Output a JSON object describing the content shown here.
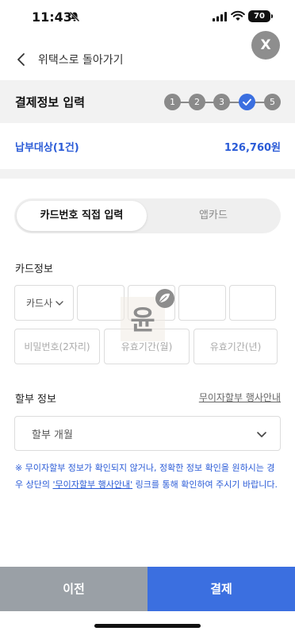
{
  "status_bar": {
    "time": "11:43",
    "battery": "70"
  },
  "close": {
    "label": "X"
  },
  "nav": {
    "back_label": "위택스로 돌아가기"
  },
  "step_header": {
    "title": "결제정보 입력",
    "steps": [
      "1",
      "2",
      "3",
      "",
      "5"
    ],
    "current_step": 4
  },
  "pay_target": {
    "label": "납부대상(1건)",
    "amount": "126,760원"
  },
  "tabs": {
    "direct": "카드번호 직접 입력",
    "app": "앱카드"
  },
  "card_info": {
    "label": "카드정보",
    "company_placeholder": "카드사",
    "password_placeholder": "비밀번호(2자리)",
    "expiry_month_placeholder": "유효기간(월)",
    "expiry_year_placeholder": "유효기간(년)"
  },
  "installment": {
    "label": "할부 정보",
    "link": "무이자할부 행사안내",
    "select_placeholder": "할부 개월",
    "notice_pre": "※ 무이자할부 정보가 확인되지 않거나, 정확한 정보 확인을 원하시는 경우 상단의 ",
    "notice_link": "'무이자할부 행사안내'",
    "notice_post": " 링크를 통해 확인하여 주시기 바랍니다."
  },
  "buttons": {
    "prev": "이전",
    "pay": "결제"
  },
  "watermark": {
    "char": "윤"
  },
  "colors": {
    "accent": "#3b6fe0",
    "blue_text": "#2a5bd7",
    "prev_button": "#9aa0a6",
    "step_gray": "#8a8a8a"
  }
}
